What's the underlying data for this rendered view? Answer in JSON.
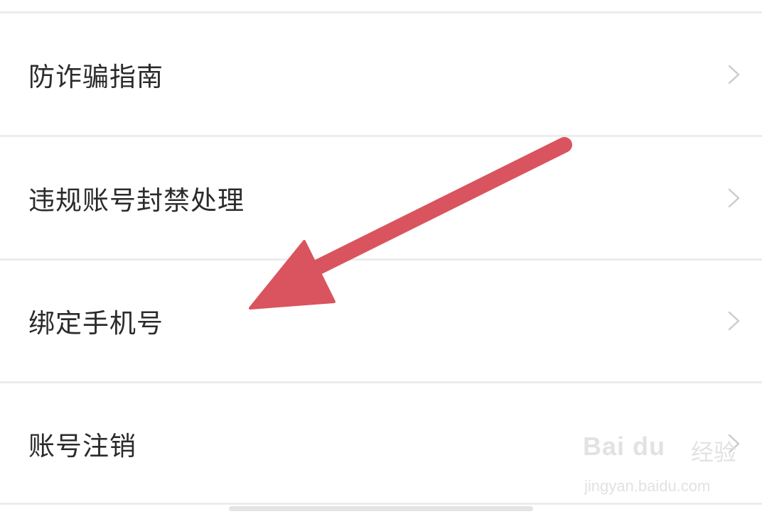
{
  "menu": {
    "items": [
      {
        "label": "防诈骗指南",
        "icon": "chevron-right-icon"
      },
      {
        "label": "违规账号封禁处理",
        "icon": "chevron-right-icon"
      },
      {
        "label": "绑定手机号",
        "icon": "chevron-right-icon"
      },
      {
        "label": "账号注销",
        "icon": "chevron-right-icon"
      }
    ]
  },
  "annotation": {
    "type": "arrow",
    "color": "#d9545e"
  },
  "watermark": {
    "logo": "Bai du",
    "brand": "经验",
    "url": "jingyan.baidu.com"
  },
  "colors": {
    "background": "#ffffff",
    "text": "#2b2b2b",
    "separator": "#ececec",
    "chevron": "#cccccc"
  }
}
